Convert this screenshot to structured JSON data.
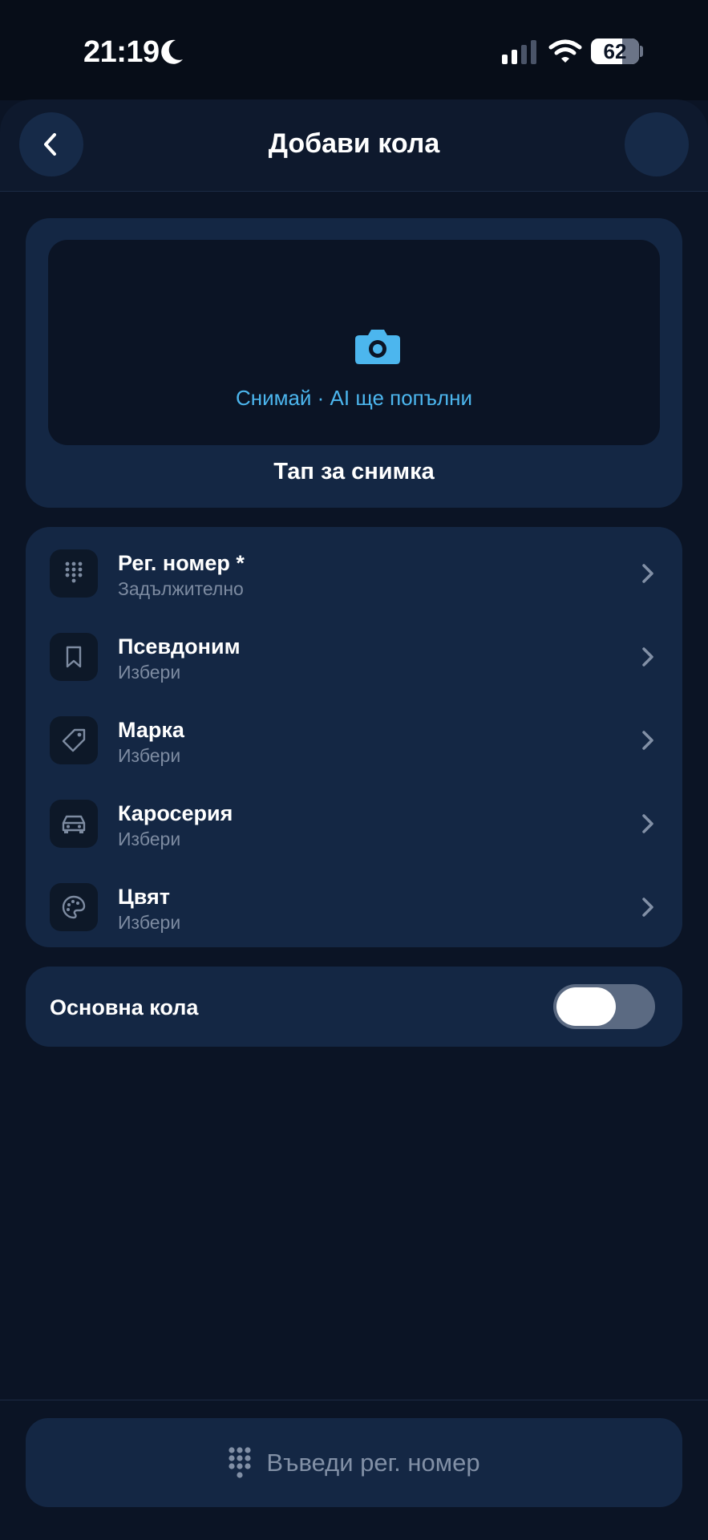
{
  "status_bar": {
    "time": "21:19",
    "battery": "62"
  },
  "header": {
    "title": "Добави кола"
  },
  "photo": {
    "hint": "Снимай · AI ще попълни",
    "caption": "Тап за снимка"
  },
  "fields": [
    {
      "title": "Рег. номер *",
      "subtitle": "Задължително",
      "icon": "keypad-icon"
    },
    {
      "title": "Псевдоним",
      "subtitle": "Избери",
      "icon": "bookmark-icon"
    },
    {
      "title": "Марка",
      "subtitle": "Избери",
      "icon": "tag-icon"
    },
    {
      "title": "Каросерия",
      "subtitle": "Избери",
      "icon": "car-icon"
    },
    {
      "title": "Цвят",
      "subtitle": "Избери",
      "icon": "palette-icon"
    }
  ],
  "main_car": {
    "label": "Основна кола",
    "enabled": false
  },
  "bottom_button": {
    "label": "Въведи рег. номер"
  },
  "colors": {
    "background": "#0b1425",
    "card": "#142744",
    "accent": "#4cb6ee",
    "muted": "#7d8ba1"
  }
}
